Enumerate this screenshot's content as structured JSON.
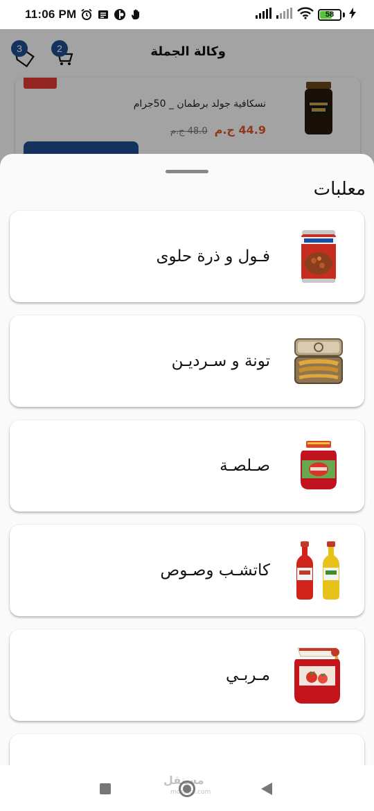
{
  "status_bar": {
    "time": "11:06 PM",
    "battery_level": "58",
    "battery_fraction": 0.58,
    "icons": [
      "alarm-icon",
      "message-icon",
      "app-icon",
      "hand-icon",
      "signal-icon",
      "signal-weak-icon",
      "wifi-icon",
      "battery-icon",
      "charging-icon"
    ]
  },
  "app": {
    "title": "وكالة الجملة",
    "cart_badge": "2",
    "favorites_badge": "3",
    "product": {
      "name": "نسكافية جولد برطمان _ 50جرام",
      "old_price": "48.0 ج.م",
      "new_price": "44.9 ج.م"
    }
  },
  "sheet": {
    "title": "معلبات",
    "categories": [
      {
        "label": "فـول و ذرة حلوى",
        "icon": "canned-beans-icon"
      },
      {
        "label": "تونة و سـرديـن",
        "icon": "sardine-can-icon"
      },
      {
        "label": "صـلصـة",
        "icon": "tomato-paste-jar-icon"
      },
      {
        "label": "كاتشـب وصـوص",
        "icon": "ketchup-bottles-icon"
      },
      {
        "label": "مـربـي",
        "icon": "jam-jar-icon"
      }
    ]
  },
  "nav_bar": {
    "watermark": "مستقل",
    "watermark_sub": "mostaql.com"
  },
  "colors": {
    "accent": "#1e4f93",
    "price": "#e05a2b",
    "discount": "#e53935",
    "battery": "#58c238"
  }
}
